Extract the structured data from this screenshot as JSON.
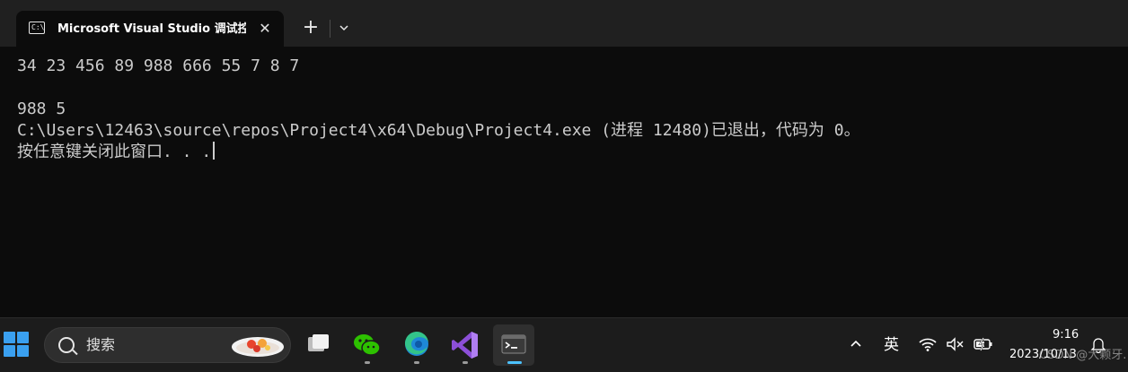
{
  "window": {
    "tab_title": "Microsoft Visual Studio 调试控制台",
    "tab_icon": "terminal-icon",
    "close_symbol": "✕",
    "new_tab_symbol": "+",
    "dropdown_symbol": "⌄"
  },
  "console": {
    "lines": [
      "34 23 456 89 988 666 55 7 8 7",
      "",
      "988 5",
      "C:\\Users\\12463\\source\\repos\\Project4\\x64\\Debug\\Project4.exe (进程 12480)已退出，代码为 0。",
      "按任意键关闭此窗口. . ."
    ],
    "text_color": "#cccccc",
    "background": "#0c0c0c"
  },
  "taskbar": {
    "search_placeholder": "搜索",
    "apps": [
      {
        "name": "task-view",
        "icon": "task-view-icon",
        "running": false
      },
      {
        "name": "wechat",
        "icon": "wechat-icon",
        "running": true
      },
      {
        "name": "edge",
        "icon": "edge-icon",
        "running": true
      },
      {
        "name": "visual-studio",
        "icon": "visual-studio-icon",
        "running": true
      },
      {
        "name": "terminal",
        "icon": "terminal-icon",
        "running": true,
        "active": true
      }
    ],
    "tray": {
      "chevron": "^",
      "input_method": "英",
      "time": "9:16",
      "date": "2023/10/13",
      "watermark": "CSDN @大颗牙."
    },
    "accent": "#4cc2ff"
  }
}
